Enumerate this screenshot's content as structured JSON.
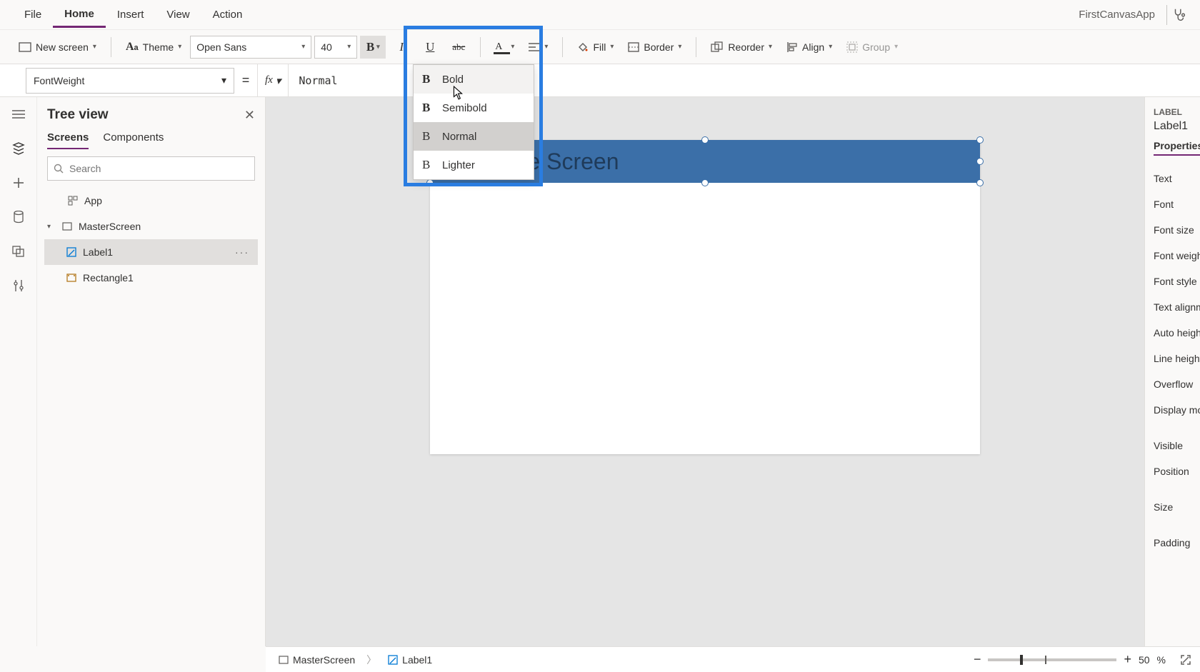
{
  "menu": {
    "file": "File",
    "home": "Home",
    "insert": "Insert",
    "view": "View",
    "action": "Action"
  },
  "appName": "FirstCanvasApp",
  "ribbon": {
    "newScreen": "New screen",
    "theme": "Theme",
    "font": "Open Sans",
    "fontSize": "40",
    "fill": "Fill",
    "border": "Border",
    "reorder": "Reorder",
    "align": "Align",
    "group": "Group"
  },
  "formula": {
    "property": "FontWeight",
    "value": "Normal"
  },
  "tree": {
    "title": "Tree view",
    "tabScreens": "Screens",
    "tabComponents": "Components",
    "searchPlaceholder": "Search",
    "app": "App",
    "screen": "MasterScreen",
    "label": "Label1",
    "rect": "Rectangle1"
  },
  "canvas": {
    "titleText": "Title of the Screen"
  },
  "boldMenu": {
    "bold": "Bold",
    "semibold": "Semibold",
    "normal": "Normal",
    "lighter": "Lighter"
  },
  "rightPanel": {
    "kind": "LABEL",
    "name": "Label1",
    "tab": "Properties",
    "rows": [
      "Text",
      "Font",
      "Font size",
      "Font weight",
      "Font style",
      "Text alignment",
      "Auto height",
      "Line height",
      "Overflow",
      "Display mode",
      "Visible",
      "Position",
      "Size",
      "Padding"
    ]
  },
  "status": {
    "screen": "MasterScreen",
    "label": "Label1",
    "zoomPct": "50",
    "pctSign": "%"
  }
}
